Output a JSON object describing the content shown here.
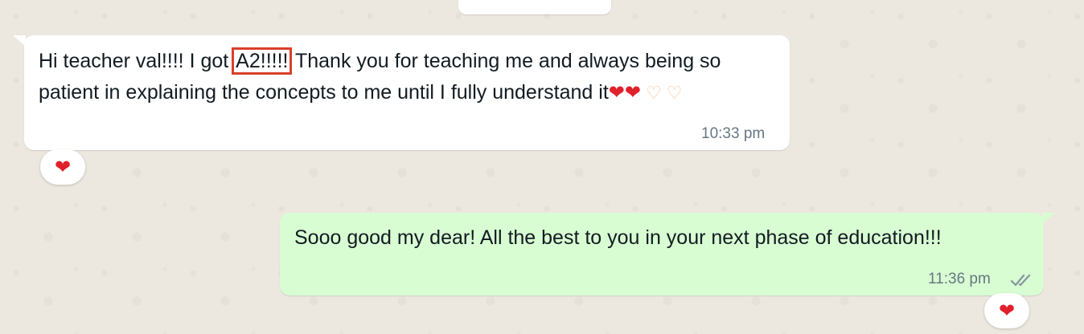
{
  "incoming_message": {
    "text_before": "Hi teacher val!!!! I got ",
    "highlighted": "A2!!!!!",
    "text_after": " Thank you for teaching me and always being so patient in explaining the concepts to me until I fully understand it",
    "emojis": [
      "red-heart",
      "red-heart",
      "heart-hands",
      "heart-hands"
    ],
    "time": "10:33 pm",
    "reaction": "❤"
  },
  "outgoing_message": {
    "text": "Sooo good my dear! All the best to you in your next phase of education!!!",
    "time": "11:36 pm",
    "status": "read",
    "reaction": "❤"
  },
  "colors": {
    "incoming_bubble": "#ffffff",
    "outgoing_bubble": "#d9fdd3",
    "highlight_box": "#d9402b",
    "read_ticks": "#8696a0",
    "background": "#ece7df"
  }
}
